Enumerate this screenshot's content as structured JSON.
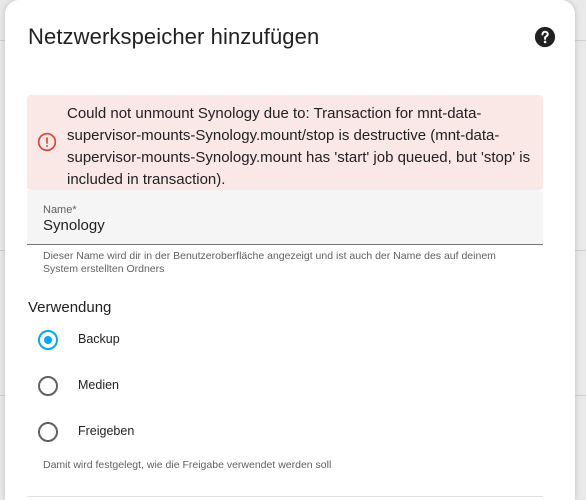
{
  "dialog": {
    "title": "Netzwerkspeicher hinzufügen",
    "help_icon": "help-circle-icon"
  },
  "alert": {
    "icon": "alert-circle-icon",
    "message": "Could not unmount Synology due to: Transaction for mnt-data-supervisor-mounts-Synology.mount/stop is destructive (mnt-data-supervisor-mounts-Synology.mount has 'start' job queued, but 'stop' is included in transaction).",
    "color": "#db4437",
    "background": "#f9e8e6"
  },
  "name_field": {
    "label": "Name*",
    "value": "Synology",
    "helper": "Dieser Name wird dir in der Benutzeroberfläche angezeigt und ist auch der Name des auf deinem System erstellten Ordners"
  },
  "usage": {
    "title": "Verwendung",
    "options": [
      {
        "label": "Backup",
        "checked": true
      },
      {
        "label": "Medien",
        "checked": false
      },
      {
        "label": "Freigeben",
        "checked": false
      }
    ],
    "helper": "Damit wird festgelegt, wie die Freigabe verwendet werden soll",
    "accent": "#03a9f4"
  }
}
